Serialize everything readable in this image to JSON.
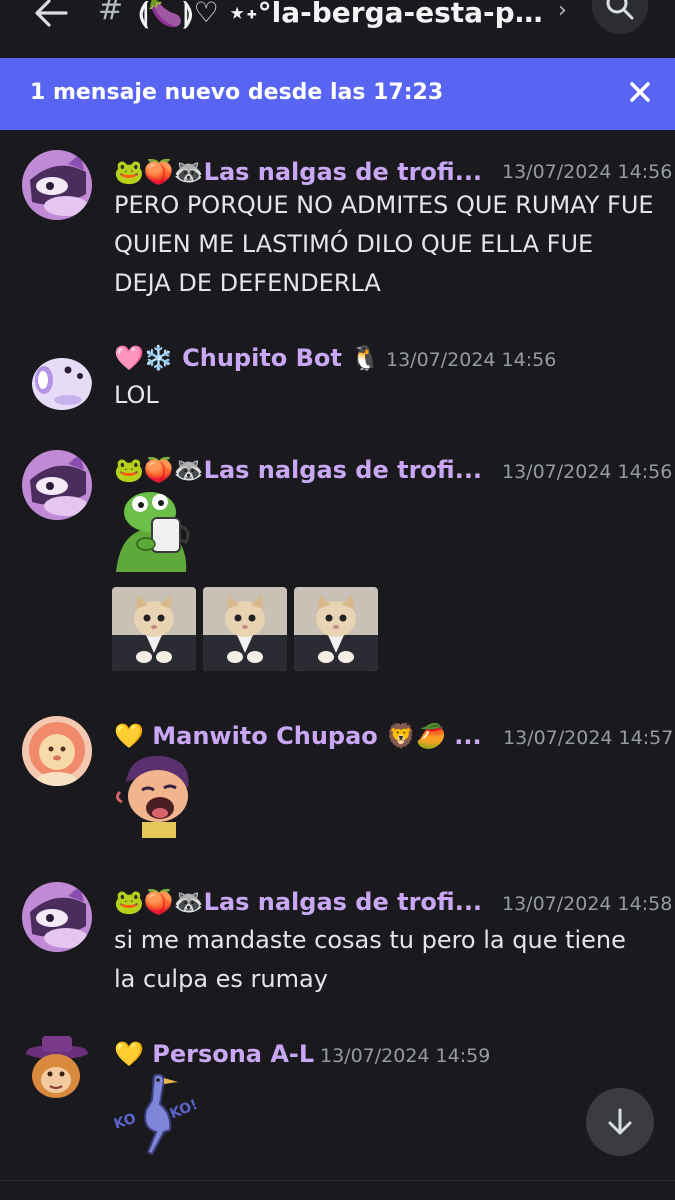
{
  "header": {
    "channel_name": "⟬🍆⟭♡ ⋆˖°la-berga-esta-pu...",
    "back_icon": "arrow-left-icon",
    "hash_icon": "hash-icon",
    "chevron_icon": "chevron-right-icon",
    "search_icon": "search-icon"
  },
  "banner": {
    "text": "1 mensaje nuevo desde las 17:23",
    "close_icon": "close-icon",
    "color": "#5865f2"
  },
  "messages": [
    {
      "author": "🐸🍑🦝Las nalgas de trofi...",
      "timestamp": "13/07/2024 14:56",
      "text": "PERO PORQUE NO ADMITES QUE RUMAY FUE QUIEN ME LASTIMÓ  DILO QUE ELLA FUE DEJA DE DEFENDERLA",
      "avatar": "raccoon-avatar"
    },
    {
      "author": "🩷❄️ Chupito Bot 🐧",
      "timestamp": "13/07/2024 14:56",
      "text": "LOL",
      "avatar": "seal-avatar"
    },
    {
      "author": "🐸🍑🦝Las nalgas de trofi...",
      "timestamp": "13/07/2024 14:56",
      "attachments": [
        "frog-mug-sticker",
        "cat-suit-emoji",
        "cat-suit-emoji",
        "cat-suit-emoji"
      ],
      "avatar": "raccoon-avatar"
    },
    {
      "author": "💛 Manwito Chupao 🦁🥭 ...",
      "timestamp": "13/07/2024 14:57",
      "attachments": [
        "laughing-person-sticker"
      ],
      "avatar": "lion-avatar"
    },
    {
      "author": "🐸🍑🦝Las nalgas de trofi...",
      "timestamp": "13/07/2024 14:58",
      "text": "si me mandaste cosas tu pero la que tiene la culpa es rumay",
      "avatar": "raccoon-avatar"
    },
    {
      "author": "💛 Persona A-L",
      "timestamp": "13/07/2024 14:59",
      "attachments": [
        "heron-koko-sticker"
      ],
      "sticker_text": "KO KO!",
      "avatar": "hat-character-avatar"
    }
  ],
  "jump_button": {
    "icon": "arrow-down-icon"
  },
  "colors": {
    "background": "#1a1a1e",
    "author": "#c9a7f5",
    "timestamp": "#949ba4",
    "text": "#e3e5e8"
  }
}
